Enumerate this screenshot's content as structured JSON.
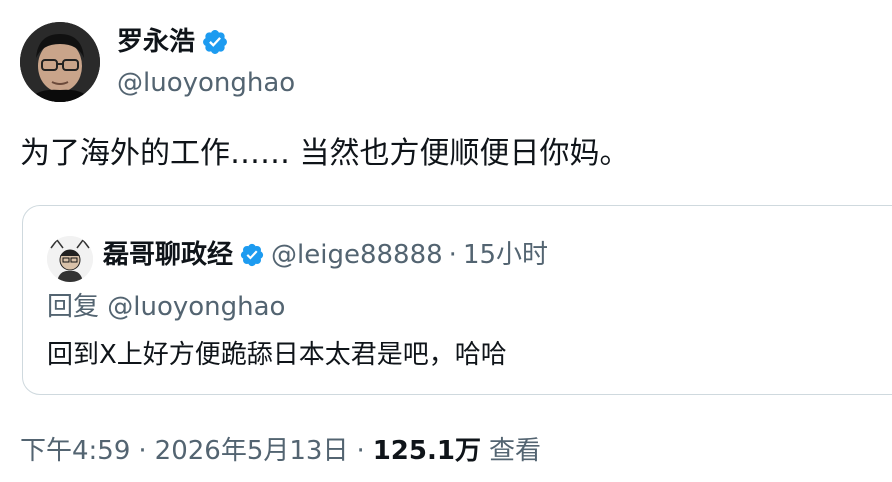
{
  "author": {
    "display_name": "罗永浩",
    "handle": "@luoyonghao",
    "verified": true
  },
  "tweet": {
    "text": "为了海外的工作…… 当然也方便顺便日你妈。"
  },
  "quote": {
    "display_name": "磊哥聊政经",
    "verified": true,
    "handle": "@leige88888",
    "separator": "·",
    "time": "15小时",
    "reply_to": "回复 @luoyonghao",
    "text": "回到X上好方便跪舔日本太君是吧，哈哈"
  },
  "meta": {
    "time": "下午4:59",
    "sep1": "·",
    "date": "2026年5月13日",
    "sep2": "·",
    "views_count": "125.1万",
    "views_label": "查看"
  },
  "colors": {
    "text_primary": "#0f1419",
    "text_secondary": "#536471",
    "verified_blue": "#1d9bf0",
    "card_border": "#cfd9de"
  },
  "icons": {
    "verified": "verified-badge-icon"
  }
}
